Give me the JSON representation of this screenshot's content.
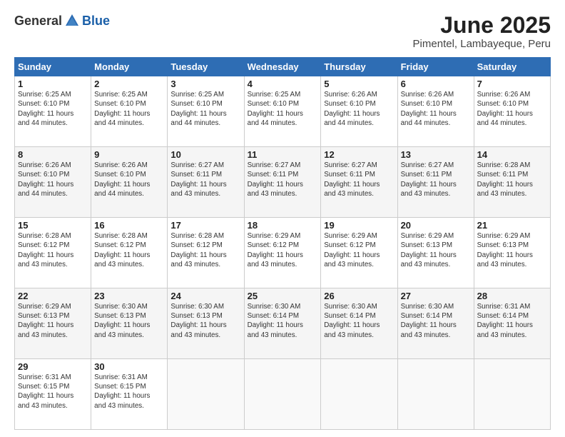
{
  "header": {
    "logo_general": "General",
    "logo_blue": "Blue",
    "month": "June 2025",
    "location": "Pimentel, Lambayeque, Peru"
  },
  "days_of_week": [
    "Sunday",
    "Monday",
    "Tuesday",
    "Wednesday",
    "Thursday",
    "Friday",
    "Saturday"
  ],
  "weeks": [
    [
      {
        "day": "1",
        "info": "Sunrise: 6:25 AM\nSunset: 6:10 PM\nDaylight: 11 hours\nand 44 minutes."
      },
      {
        "day": "2",
        "info": "Sunrise: 6:25 AM\nSunset: 6:10 PM\nDaylight: 11 hours\nand 44 minutes."
      },
      {
        "day": "3",
        "info": "Sunrise: 6:25 AM\nSunset: 6:10 PM\nDaylight: 11 hours\nand 44 minutes."
      },
      {
        "day": "4",
        "info": "Sunrise: 6:25 AM\nSunset: 6:10 PM\nDaylight: 11 hours\nand 44 minutes."
      },
      {
        "day": "5",
        "info": "Sunrise: 6:26 AM\nSunset: 6:10 PM\nDaylight: 11 hours\nand 44 minutes."
      },
      {
        "day": "6",
        "info": "Sunrise: 6:26 AM\nSunset: 6:10 PM\nDaylight: 11 hours\nand 44 minutes."
      },
      {
        "day": "7",
        "info": "Sunrise: 6:26 AM\nSunset: 6:10 PM\nDaylight: 11 hours\nand 44 minutes."
      }
    ],
    [
      {
        "day": "8",
        "info": "Sunrise: 6:26 AM\nSunset: 6:10 PM\nDaylight: 11 hours\nand 44 minutes."
      },
      {
        "day": "9",
        "info": "Sunrise: 6:26 AM\nSunset: 6:10 PM\nDaylight: 11 hours\nand 44 minutes."
      },
      {
        "day": "10",
        "info": "Sunrise: 6:27 AM\nSunset: 6:11 PM\nDaylight: 11 hours\nand 43 minutes."
      },
      {
        "day": "11",
        "info": "Sunrise: 6:27 AM\nSunset: 6:11 PM\nDaylight: 11 hours\nand 43 minutes."
      },
      {
        "day": "12",
        "info": "Sunrise: 6:27 AM\nSunset: 6:11 PM\nDaylight: 11 hours\nand 43 minutes."
      },
      {
        "day": "13",
        "info": "Sunrise: 6:27 AM\nSunset: 6:11 PM\nDaylight: 11 hours\nand 43 minutes."
      },
      {
        "day": "14",
        "info": "Sunrise: 6:28 AM\nSunset: 6:11 PM\nDaylight: 11 hours\nand 43 minutes."
      }
    ],
    [
      {
        "day": "15",
        "info": "Sunrise: 6:28 AM\nSunset: 6:12 PM\nDaylight: 11 hours\nand 43 minutes."
      },
      {
        "day": "16",
        "info": "Sunrise: 6:28 AM\nSunset: 6:12 PM\nDaylight: 11 hours\nand 43 minutes."
      },
      {
        "day": "17",
        "info": "Sunrise: 6:28 AM\nSunset: 6:12 PM\nDaylight: 11 hours\nand 43 minutes."
      },
      {
        "day": "18",
        "info": "Sunrise: 6:29 AM\nSunset: 6:12 PM\nDaylight: 11 hours\nand 43 minutes."
      },
      {
        "day": "19",
        "info": "Sunrise: 6:29 AM\nSunset: 6:12 PM\nDaylight: 11 hours\nand 43 minutes."
      },
      {
        "day": "20",
        "info": "Sunrise: 6:29 AM\nSunset: 6:13 PM\nDaylight: 11 hours\nand 43 minutes."
      },
      {
        "day": "21",
        "info": "Sunrise: 6:29 AM\nSunset: 6:13 PM\nDaylight: 11 hours\nand 43 minutes."
      }
    ],
    [
      {
        "day": "22",
        "info": "Sunrise: 6:29 AM\nSunset: 6:13 PM\nDaylight: 11 hours\nand 43 minutes."
      },
      {
        "day": "23",
        "info": "Sunrise: 6:30 AM\nSunset: 6:13 PM\nDaylight: 11 hours\nand 43 minutes."
      },
      {
        "day": "24",
        "info": "Sunrise: 6:30 AM\nSunset: 6:13 PM\nDaylight: 11 hours\nand 43 minutes."
      },
      {
        "day": "25",
        "info": "Sunrise: 6:30 AM\nSunset: 6:14 PM\nDaylight: 11 hours\nand 43 minutes."
      },
      {
        "day": "26",
        "info": "Sunrise: 6:30 AM\nSunset: 6:14 PM\nDaylight: 11 hours\nand 43 minutes."
      },
      {
        "day": "27",
        "info": "Sunrise: 6:30 AM\nSunset: 6:14 PM\nDaylight: 11 hours\nand 43 minutes."
      },
      {
        "day": "28",
        "info": "Sunrise: 6:31 AM\nSunset: 6:14 PM\nDaylight: 11 hours\nand 43 minutes."
      }
    ],
    [
      {
        "day": "29",
        "info": "Sunrise: 6:31 AM\nSunset: 6:15 PM\nDaylight: 11 hours\nand 43 minutes."
      },
      {
        "day": "30",
        "info": "Sunrise: 6:31 AM\nSunset: 6:15 PM\nDaylight: 11 hours\nand 43 minutes."
      },
      {
        "day": "",
        "info": ""
      },
      {
        "day": "",
        "info": ""
      },
      {
        "day": "",
        "info": ""
      },
      {
        "day": "",
        "info": ""
      },
      {
        "day": "",
        "info": ""
      }
    ]
  ]
}
